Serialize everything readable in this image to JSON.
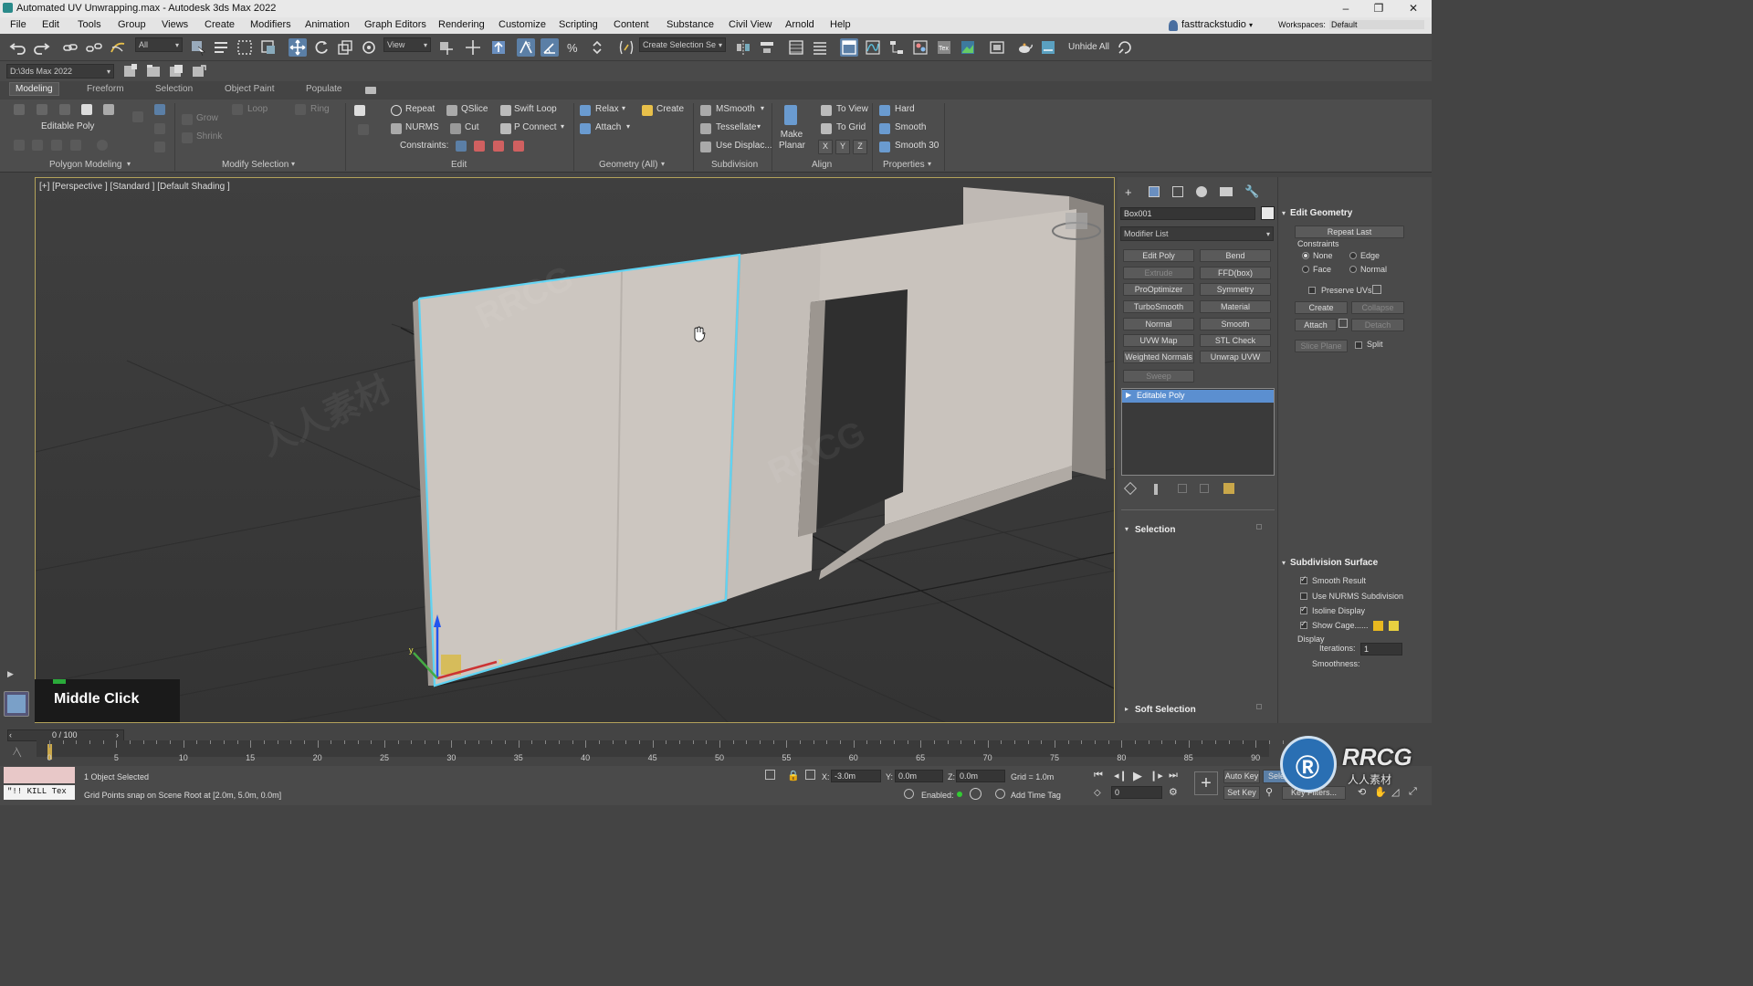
{
  "titlebar": {
    "title": "Automated UV Unwrapping.max - Autodesk 3ds Max 2022"
  },
  "menu": [
    "File",
    "Edit",
    "Tools",
    "Group",
    "Views",
    "Create",
    "Modifiers",
    "Animation",
    "Graph Editors",
    "Rendering",
    "Customize",
    "Scripting",
    "Content",
    "Substance",
    "Civil View",
    "Arnold",
    "Help"
  ],
  "account": {
    "user": "fasttrackstudio",
    "workspaces_label": "Workspaces:",
    "workspace": "Default"
  },
  "toolbar": {
    "filter": "All",
    "ref_coord": "View",
    "selection_set": "Create Selection Se",
    "unhide": "Unhide All"
  },
  "project": {
    "path": "D:\\3ds Max 2022"
  },
  "ribbon_tabs": [
    "Modeling",
    "Freeform",
    "Selection",
    "Object Paint",
    "Populate"
  ],
  "ribbon": {
    "editable_poly": "Editable Poly",
    "grow": "Grow",
    "shrink": "Shrink",
    "loop": "Loop",
    "ring": "Ring",
    "repeat": "Repeat",
    "qslice": "QSlice",
    "swift_loop": "Swift Loop",
    "nurms": "NURMS",
    "cut": "Cut",
    "p_connect": "P Connect",
    "constraints": "Constraints:",
    "relax": "Relax",
    "create": "Create",
    "attach": "Attach",
    "msmooth": "MSmooth",
    "tessellate": "Tessellate",
    "use_displac": "Use Displac...",
    "make_planar": "Make Planar",
    "to_view": "To View",
    "to_grid": "To Grid",
    "x": "X",
    "y": "Y",
    "z": "Z",
    "hard": "Hard",
    "smooth": "Smooth",
    "smooth30": "Smooth 30",
    "groups": {
      "polygon_modeling": "Polygon Modeling",
      "modify_selection": "Modify Selection",
      "edit": "Edit",
      "geometry_all": "Geometry (All)",
      "subdivision": "Subdivision",
      "align": "Align",
      "properties": "Properties"
    }
  },
  "viewport": {
    "label": "[+] [Perspective ] [Standard ] [Default Shading ]",
    "overlay": "Middle Click"
  },
  "cmdpanel": {
    "object_name": "Box001",
    "modifier_list": "Modifier List",
    "modifier_buttons": [
      [
        "Edit Poly",
        "Bend"
      ],
      [
        "Extrude",
        "FFD(box)"
      ],
      [
        "ProOptimizer",
        "Symmetry"
      ],
      [
        "TurboSmooth",
        "Material"
      ],
      [
        "Normal",
        "Smooth"
      ],
      [
        "UVW Map",
        "STL Check"
      ],
      [
        "Weighted Normals",
        "Unwrap UVW"
      ],
      [
        "Sweep",
        ""
      ]
    ],
    "stack_item": "Editable Poly",
    "selection": "Selection",
    "soft_selection": "Soft Selection"
  },
  "rollout": {
    "edit_geometry": "Edit Geometry",
    "repeat_last": "Repeat Last",
    "constraints": "Constraints",
    "none": "None",
    "edge": "Edge",
    "face": "Face",
    "normal": "Normal",
    "preserve_uvs": "Preserve UVs",
    "create": "Create",
    "collapse": "Collapse",
    "attach": "Attach",
    "detach": "Detach",
    "slice_plane": "Slice Plane",
    "split": "Split",
    "subdivision_surface": "Subdivision Surface",
    "smooth_result": "Smooth Result",
    "use_nurms": "Use NURMS Subdivision",
    "isoline": "Isoline Display",
    "show_cage": "Show Cage......",
    "display": "Display",
    "iterations_label": "Iterations:",
    "iterations": "1",
    "smoothness_label": "Smoothness:"
  },
  "timeline": {
    "frame": "0 / 100",
    "ticks": [
      "0",
      "5",
      "10",
      "15",
      "20",
      "25",
      "30",
      "35",
      "40",
      "45",
      "50",
      "55",
      "60",
      "65",
      "70",
      "75",
      "80",
      "85",
      "90"
    ]
  },
  "status": {
    "maxscript": "\"!! KILL Tex",
    "selected": "1 Object Selected",
    "prompt": "Grid Points snap on Scene Root at [2.0m, 5.0m, 0.0m]",
    "x_label": "X:",
    "x": "-3.0m",
    "y_label": "Y:",
    "y": "0.0m",
    "z_label": "Z:",
    "z": "0.0m",
    "grid": "Grid = 1.0m",
    "enabled": "Enabled:",
    "add_time_tag": "Add Time Tag",
    "auto_key": "Auto Key",
    "set_key": "Set Key",
    "selected_btn": "Sele",
    "key_filters": "Key Filters...",
    "frame_field": "0"
  },
  "watermark": {
    "logo": "RRCG",
    "sub": "人人素材"
  }
}
